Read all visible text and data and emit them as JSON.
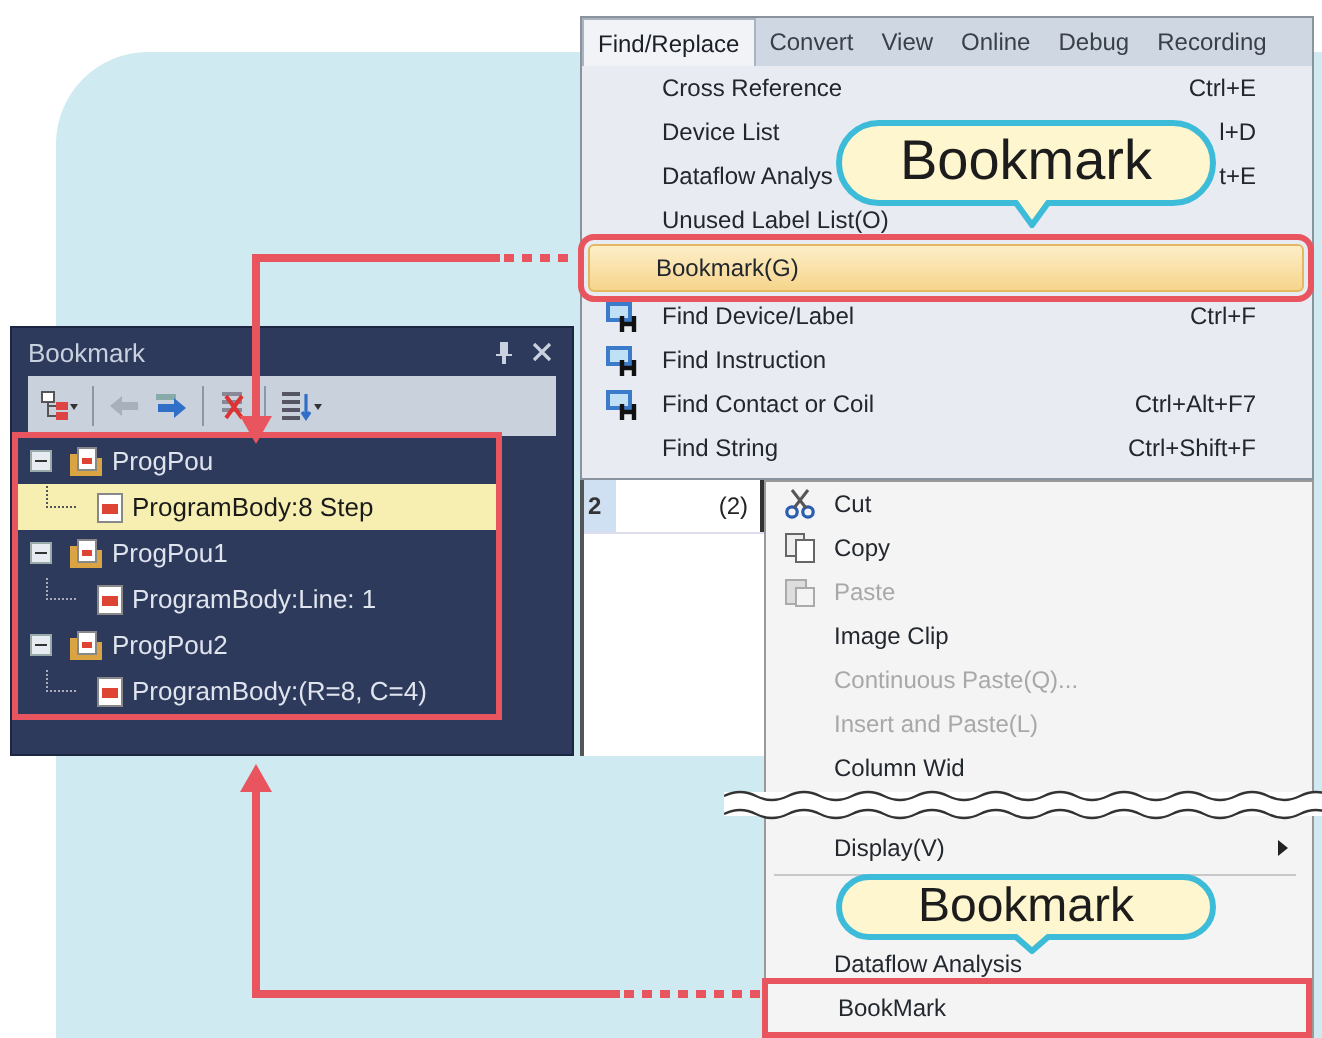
{
  "bookmark_panel": {
    "title": "Bookmark",
    "framed": true,
    "tree": [
      {
        "label": "ProgPou",
        "expanded": true,
        "selected": false,
        "children": [
          {
            "label": "ProgramBody:8 Step",
            "selected": true
          }
        ]
      },
      {
        "label": "ProgPou1",
        "expanded": true,
        "selected": false,
        "children": [
          {
            "label": "ProgramBody:Line: 1",
            "selected": false
          }
        ]
      },
      {
        "label": "ProgPou2",
        "expanded": true,
        "selected": false,
        "children": [
          {
            "label": "ProgramBody:(R=8, C=4)",
            "selected": false
          }
        ]
      }
    ]
  },
  "main_menu": {
    "menubar": [
      {
        "label": "Find/Replace",
        "selected": true
      },
      {
        "label": "Convert",
        "selected": false
      },
      {
        "label": "View",
        "selected": false
      },
      {
        "label": "Online",
        "selected": false
      },
      {
        "label": "Debug",
        "selected": false
      },
      {
        "label": "Recording",
        "selected": false
      }
    ],
    "items": [
      {
        "kind": "plain",
        "label": "Cross Reference",
        "shortcut": "Ctrl+E",
        "selected": false,
        "framed": false
      },
      {
        "kind": "plain",
        "label": "Device List",
        "shortcut": "l+D",
        "selected": false,
        "framed": false
      },
      {
        "kind": "plain",
        "label": "Dataflow Analys",
        "shortcut": "t+E",
        "selected": false,
        "framed": false
      },
      {
        "kind": "plain",
        "label": "Unused Label List(O)",
        "selected": false,
        "framed": false
      },
      {
        "kind": "plain",
        "label": "Bookmark(G)",
        "selected": true,
        "framed": true
      },
      {
        "kind": "icon",
        "label": "Find Device/Label",
        "shortcut": "Ctrl+F",
        "selected": false,
        "framed": false
      },
      {
        "kind": "icon",
        "label": "Find Instruction",
        "selected": false,
        "framed": false
      },
      {
        "kind": "icon",
        "label": "Find Contact or Coil",
        "shortcut": "Ctrl+Alt+F7",
        "selected": false,
        "framed": false
      },
      {
        "kind": "plain",
        "label": "Find String",
        "shortcut": "Ctrl+Shift+F",
        "selected": false,
        "framed": false
      }
    ]
  },
  "editor_grid": {
    "row_number": "2",
    "cell": "(2)"
  },
  "context_menu": {
    "items": [
      {
        "kind": "cut",
        "label": "Cut",
        "disabled": false
      },
      {
        "kind": "copy",
        "label": "Copy",
        "disabled": false
      },
      {
        "kind": "paste",
        "label": "Paste",
        "disabled": true
      },
      {
        "kind": "plain",
        "label": "Image Clip",
        "disabled": false
      },
      {
        "kind": "plain",
        "label": "Continuous Paste(Q)...",
        "disabled": true
      },
      {
        "kind": "plain",
        "label": "Insert and Paste(L)",
        "disabled": true
      },
      {
        "kind": "plain",
        "label": "Column Wid",
        "disabled": false
      }
    ],
    "items_after_break": [
      {
        "kind": "submenu",
        "label": "Display(V)",
        "disabled": false,
        "framed": false
      },
      {
        "kind": "separator"
      },
      {
        "kind": "spacer"
      },
      {
        "kind": "plain",
        "label": "Dataflow Analysis",
        "disabled": false,
        "framed": false
      },
      {
        "kind": "plain",
        "label": "BookMark",
        "disabled": false,
        "framed": true
      }
    ]
  },
  "callouts": [
    {
      "text": "Bookmark"
    },
    {
      "text": "Bookmark"
    }
  ]
}
